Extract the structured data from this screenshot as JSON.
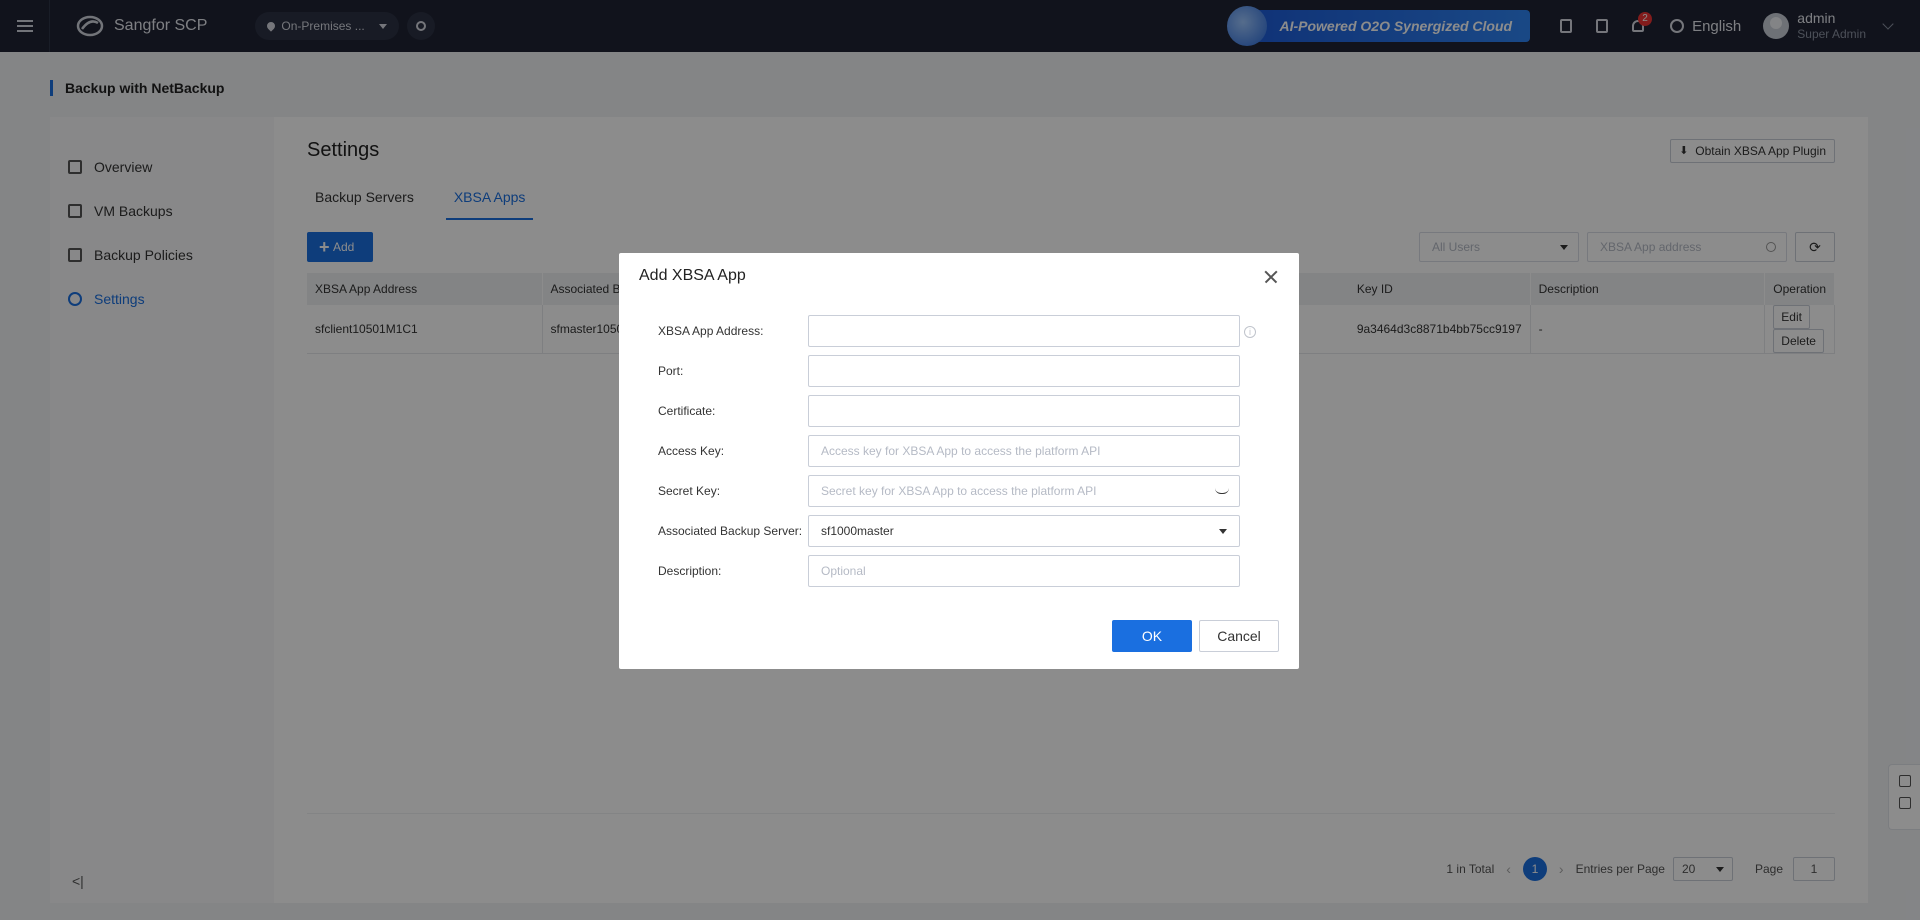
{
  "topbar": {
    "app_name": "Sangfor SCP",
    "region": "On-Premises ...",
    "banner": "AI-Powered O2O Synergized Cloud",
    "notification_count": "2",
    "language": "English",
    "user_name": "admin",
    "user_role": "Super Admin"
  },
  "page": {
    "header": "Backup with NetBackup",
    "title": "Settings",
    "plugin_button": "Obtain XBSA App Plugin",
    "collapse": "<|"
  },
  "sidebar": {
    "items": [
      {
        "label": "Overview",
        "icon": "grid-icon"
      },
      {
        "label": "VM Backups",
        "icon": "layers-icon"
      },
      {
        "label": "Backup Policies",
        "icon": "list-icon"
      },
      {
        "label": "Settings",
        "icon": "gear-icon"
      }
    ]
  },
  "tabs": [
    "Backup Servers",
    "XBSA Apps"
  ],
  "toolbar": {
    "add": "Add",
    "user_filter": "All Users",
    "search_placeholder": "XBSA App address",
    "refresh": "⟳"
  },
  "table": {
    "headers": [
      "XBSA App Address",
      "Associated B",
      "Key ID",
      "Description",
      "Operation"
    ],
    "rows": [
      {
        "address": "sfclient10501M1C1",
        "server": "sfmaster1050",
        "key_id": "9a3464d3c8871b4bb75cc9197",
        "description": "-",
        "edit": "Edit",
        "delete": "Delete"
      }
    ]
  },
  "pager": {
    "total": "1 in Total",
    "prev": "‹",
    "current": "1",
    "next": "›",
    "entries_label": "Entries per Page",
    "entries": "20",
    "page_label": "Page",
    "page": "1"
  },
  "modal": {
    "title": "Add XBSA App",
    "fields": {
      "address_label": "XBSA App Address:",
      "port_label": "Port:",
      "certificate_label": "Certificate:",
      "access_key_label": "Access Key:",
      "access_key_placeholder": "Access key for XBSA App to access the platform API",
      "secret_key_label": "Secret Key:",
      "secret_key_placeholder": "Secret key for XBSA App to access the platform API",
      "backup_server_label": "Associated Backup Server:",
      "backup_server_value": "sf1000master",
      "description_label": "Description:",
      "description_placeholder": "Optional"
    },
    "ok": "OK",
    "cancel": "Cancel"
  },
  "colors": {
    "topbar": "#1f2433",
    "accent": "#1a6fe0"
  }
}
